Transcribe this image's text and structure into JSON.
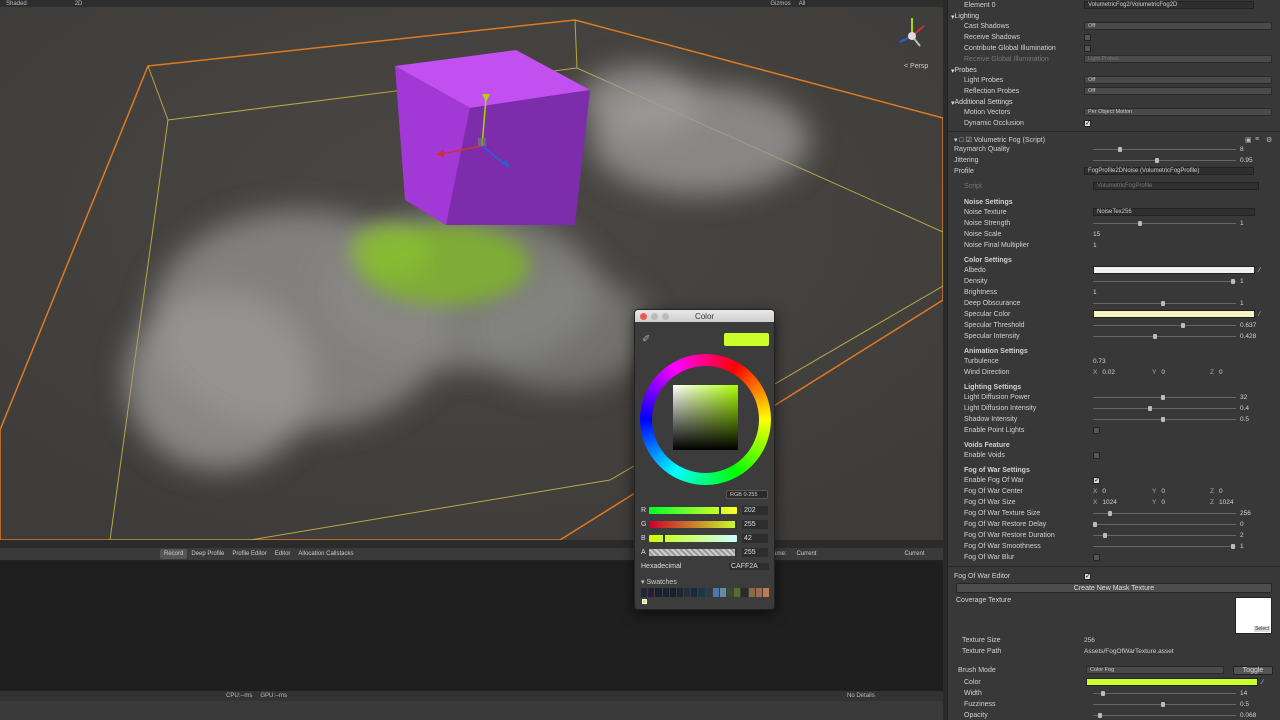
{
  "scene": {
    "toolbar": {
      "shading": "Shaded",
      "mode_2d": "2D",
      "gizmos": "Gizmos",
      "search": "All"
    },
    "persp_label": "< Persp"
  },
  "profiler": {
    "buttons": [
      "Record",
      "Deep Profile",
      "Profile Editor",
      "Editor",
      "Allocation Callstacks"
    ],
    "frame_label": "Frame:",
    "frame_value": "Current",
    "current_btn": "Current",
    "cpu": "CPU:--ms",
    "gpu": "GPU:--ms",
    "no_details": "No Details"
  },
  "color_picker": {
    "title": "Color",
    "current_color": "#CAFF2A",
    "mode": "RGB 0-255",
    "channels": [
      {
        "label": "R",
        "value": "202"
      },
      {
        "label": "G",
        "value": "255"
      },
      {
        "label": "B",
        "value": "42"
      },
      {
        "label": "A",
        "value": "255"
      }
    ],
    "hex_label": "Hexadecimal",
    "hex_value": "CAFF2A",
    "swatches_label": "Swatches"
  },
  "inspector": {
    "element0": {
      "label": "Element 0",
      "value": "VolumetricFog2/VolumetricFog2D"
    },
    "lighting": {
      "title": "Lighting",
      "cast_shadows": {
        "label": "Cast Shadows",
        "value": "Off"
      },
      "receive_shadows": "Receive Shadows",
      "contribute_gi": "Contribute Global Illumination",
      "receive_gi": {
        "label": "Receive Global Illumination",
        "value": "Light Probes"
      }
    },
    "probes": {
      "title": "Probes",
      "light_probes": {
        "label": "Light Probes",
        "value": "Off"
      },
      "reflection_probes": {
        "label": "Reflection Probes",
        "value": "Off"
      }
    },
    "additional": {
      "title": "Additional Settings",
      "motion_vectors": {
        "label": "Motion Vectors",
        "value": "Per Object Motion"
      },
      "dynamic_occlusion": "Dynamic Occlusion"
    },
    "script_component": {
      "title": "Volumetric Fog (Script)",
      "raymarch_quality": {
        "label": "Raymarch Quality",
        "value": "8"
      },
      "jittering": {
        "label": "Jittering",
        "value": "0.95"
      },
      "profile": {
        "label": "Profile",
        "value": "FogProfile2DNoise (VolumetricFogProfile)"
      }
    },
    "script_row": {
      "label": "Script",
      "value": "VolumetricFogProfile"
    },
    "noise": {
      "title": "Noise Settings",
      "texture": {
        "label": "Noise Texture",
        "value": "NoiseTex256"
      },
      "strength": {
        "label": "Noise Strength",
        "value": "1"
      },
      "scale": {
        "label": "Noise Scale",
        "value": "15"
      },
      "final_mult": {
        "label": "Noise Final Multiplier",
        "value": "1"
      }
    },
    "color_settings": {
      "title": "Color Settings",
      "albedo": "Albedo",
      "density": {
        "label": "Density",
        "value": "1"
      },
      "brightness": {
        "label": "Brightness",
        "value": "1"
      },
      "deep_obscurance": {
        "label": "Deep Obscurance",
        "value": "1"
      },
      "specular_color": "Specular Color",
      "specular_threshold": {
        "label": "Specular Threshold",
        "value": "0.637"
      },
      "specular_intensity": {
        "label": "Specular Intensity",
        "value": "0.428"
      },
      "albedo_color": "#f0f0f0",
      "specular_color_value": "#f7f4c3"
    },
    "animation": {
      "title": "Animation Settings",
      "turbulence": {
        "label": "Turbulence",
        "value": "0.73"
      },
      "wind": {
        "label": "Wind Direction",
        "x": "0.02",
        "y": "0",
        "z": "0"
      }
    },
    "lighting_settings": {
      "title": "Lighting Settings",
      "diffusion_power": {
        "label": "Light Diffusion Power",
        "value": "32"
      },
      "diffusion_intensity": {
        "label": "Light Diffusion Intensity",
        "value": "0.4"
      },
      "shadow_intensity": {
        "label": "Shadow Intensity",
        "value": "0.5"
      },
      "point_lights": "Enable Point Lights"
    },
    "voids": {
      "title": "Voids Feature",
      "enable": "Enable Voids"
    },
    "fow": {
      "title": "Fog of War Settings",
      "enable": "Enable Fog Of War",
      "center": {
        "label": "Fog Of War Center",
        "x": "0",
        "y": "0",
        "z": "0"
      },
      "size": {
        "label": "Fog Of War Size",
        "x": "1024",
        "y": "0",
        "z": "1024"
      },
      "texture_size": {
        "label": "Fog Of War Texture Size",
        "value": "256"
      },
      "restore_delay": {
        "label": "Fog Of War Restore Delay",
        "value": "0"
      },
      "restore_duration": {
        "label": "Fog Of War Restore Duration",
        "value": "2"
      },
      "smoothness": {
        "label": "Fog Of War Smoothness",
        "value": "1"
      },
      "blur": "Fog Of War Blur"
    },
    "fow_editor": {
      "label": "Fog Of War Editor",
      "create_btn": "Create New Mask Texture",
      "coverage": "Coverage Texture",
      "select": "Select",
      "texture_size": {
        "label": "Texture Size",
        "value": "256"
      },
      "texture_path": {
        "label": "Texture Path",
        "value": "Assets/FogOfWarTexture.asset"
      },
      "brush_mode": {
        "label": "Brush Mode",
        "value": "Color Fog"
      },
      "toggle": "Toggle",
      "color": "Color",
      "width": {
        "label": "Width",
        "value": "14"
      },
      "fuzziness": {
        "label": "Fuzziness",
        "value": "0.5"
      },
      "opacity": {
        "label": "Opacity",
        "value": "0.068"
      },
      "brush_color": "#caff2a"
    }
  }
}
